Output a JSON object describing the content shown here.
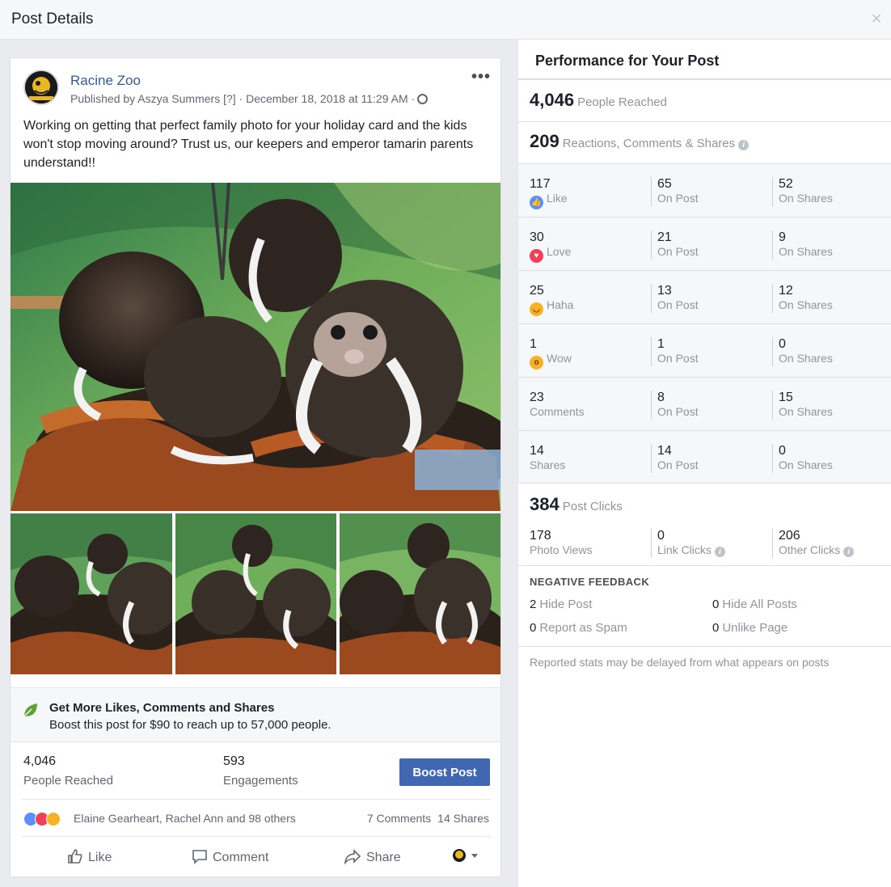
{
  "header": {
    "title": "Post Details",
    "close_glyph": "×"
  },
  "post": {
    "page_name": "Racine Zoo",
    "byline": "Published by Aszya Summers [?] · December 18, 2018 at 11:29 AM ·",
    "more_glyph": "•••",
    "text": "Working on getting that perfect family photo for your holiday card and the kids won't stop moving around? Trust us, our keepers and emperor tamarin parents understand!!",
    "promo": {
      "title": "Get More Likes, Comments and Shares",
      "subtitle": "Boost this post for $90 to reach up to 57,000 people."
    },
    "stats": {
      "reached_value": "4,046",
      "reached_label": "People Reached",
      "engagements_value": "593",
      "engagements_label": "Engagements",
      "boost_label": "Boost Post"
    },
    "reactions": {
      "names": "Elaine Gearheart, Rachel Ann and 98 others",
      "comments": "7 Comments",
      "shares": "14 Shares"
    },
    "actions": {
      "like": "Like",
      "comment": "Comment",
      "share": "Share"
    }
  },
  "performance": {
    "title": "Performance for Your Post",
    "reached": {
      "value": "4,046",
      "label": "People Reached"
    },
    "reactions": {
      "value": "209",
      "label": "Reactions, Comments & Shares"
    },
    "rows": [
      {
        "total": "117",
        "label": "Like",
        "icon": "like-icon",
        "on_post": "65",
        "on_post_label": "On Post",
        "on_shares": "52",
        "on_shares_label": "On Shares"
      },
      {
        "total": "30",
        "label": "Love",
        "icon": "love-icon",
        "on_post": "21",
        "on_post_label": "On Post",
        "on_shares": "9",
        "on_shares_label": "On Shares"
      },
      {
        "total": "25",
        "label": "Haha",
        "icon": "haha-icon",
        "on_post": "13",
        "on_post_label": "On Post",
        "on_shares": "12",
        "on_shares_label": "On Shares"
      },
      {
        "total": "1",
        "label": "Wow",
        "icon": "wow-icon",
        "on_post": "1",
        "on_post_label": "On Post",
        "on_shares": "0",
        "on_shares_label": "On Shares"
      },
      {
        "total": "23",
        "label": "Comments",
        "icon": "",
        "on_post": "8",
        "on_post_label": "On Post",
        "on_shares": "15",
        "on_shares_label": "On Shares"
      },
      {
        "total": "14",
        "label": "Shares",
        "icon": "",
        "on_post": "14",
        "on_post_label": "On Post",
        "on_shares": "0",
        "on_shares_label": "On Shares"
      }
    ],
    "clicks": {
      "value": "384",
      "label": "Post Clicks",
      "photo_views": "178",
      "photo_views_label": "Photo Views",
      "link_clicks": "0",
      "link_clicks_label": "Link Clicks",
      "other_clicks": "206",
      "other_clicks_label": "Other Clicks"
    },
    "negative": {
      "title": "NEGATIVE FEEDBACK",
      "hide_post": "2",
      "hide_post_label": "Hide Post",
      "hide_all": "0",
      "hide_all_label": "Hide All Posts",
      "spam": "0",
      "spam_label": "Report as Spam",
      "unlike": "0",
      "unlike_label": "Unlike Page"
    },
    "footnote": "Reported stats may be delayed from what appears on posts"
  },
  "colors": {
    "link_blue": "#365899",
    "button_blue": "#4267b2",
    "love_red": "#f33e58",
    "haha_yellow": "#f7b125",
    "promo_green": "#5fa135"
  }
}
